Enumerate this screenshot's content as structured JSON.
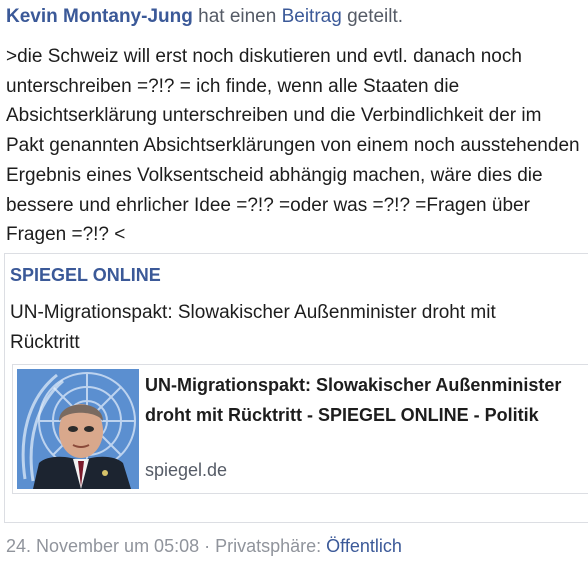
{
  "header": {
    "author": "Kevin Montany-Jung",
    "verb": " hat einen ",
    "object_link": "Beitrag",
    "suffix": " geteilt."
  },
  "post": {
    "text": ">die Schweiz will erst noch diskutieren und evtl. danach noch unterschreiben =?!? = ich finde, wenn alle Staaten die Absichtserklärung unterschreiben und die Verbindlichkeit der im Pakt genannten Absichtserklärungen von einem noch ausstehenden Ergebnis eines Volksentscheid abhängig machen, wäre dies die bessere und ehrlicher Idee =?!? =oder was =?!? =Fragen über Fragen =?!? <"
  },
  "shared": {
    "source": "SPIEGEL ONLINE",
    "headline": "UN-Migrationspakt: Slowakischer Außenminister droht mit Rücktritt",
    "preview": {
      "title": "UN-Migrationspakt: Slowakischer Außenminister droht mit Rücktritt - SPIEGEL ONLINE - Politik",
      "domain": "spiegel.de",
      "thumbnail": "un-emblem-person-photo"
    }
  },
  "footer": {
    "timestamp": "24. November um 05:08",
    "separator": " · ",
    "privacy_label": "Privatsphäre: ",
    "privacy_value": "Öffentlich"
  },
  "colors": {
    "link": "#3b5998",
    "text": "#1d1d1d",
    "meta": "#90949c",
    "border": "#dcdee3"
  }
}
